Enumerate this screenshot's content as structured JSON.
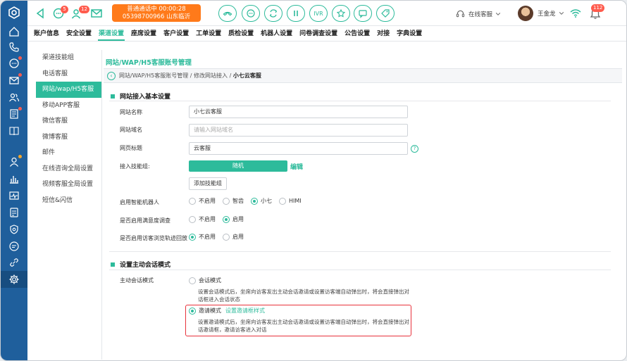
{
  "topbar": {
    "badges": {
      "messages": "5",
      "visitors": "12",
      "alerts": "112"
    },
    "call": {
      "line1": "普通通话中 00:00:28",
      "line2": "05398700966 山东临沂"
    },
    "ivr_label": "IVR",
    "status_label": "在线客服",
    "user_name": "王金龙"
  },
  "menu": {
    "items": [
      "账户信息",
      "安全设置",
      "渠道设置",
      "座席设置",
      "客户设置",
      "工单设置",
      "质检设置",
      "机器人设置",
      "问卷调查设置",
      "公告设置",
      "对接",
      "字典设置"
    ],
    "active_index": 2
  },
  "sidebar": {
    "items": [
      "渠道技能组",
      "电话客服",
      "网站/wap/H5客服",
      "移动APP客服",
      "微信客服",
      "微博客服",
      "邮件",
      "在线咨询全局设置",
      "视频客服全局设置",
      "短信&闪信"
    ],
    "active_index": 2
  },
  "main": {
    "tab_title": "网站/WAP/H5客服账号管理",
    "breadcrumb": {
      "part1": "网站/WAP/H5客服账号管理",
      "sep": " / ",
      "part2": "修改网站接入",
      "part3": "小七云客服"
    },
    "section1_title": "网站接入基本设置",
    "site_name": {
      "label": "网站名称",
      "value": "小七云客服"
    },
    "site_domain": {
      "label": "网站域名",
      "placeholder": "请输入网站域名"
    },
    "page_title": {
      "label": "网页标题",
      "value": "云客服",
      "help": "?"
    },
    "skill_group": {
      "label": "接入技能组:",
      "selected": "随机",
      "edit_link": "编辑",
      "add_button": "添加技能组"
    },
    "robot": {
      "label": "启用智能机器人",
      "options": [
        "不启用",
        "智齿",
        "小七",
        "HIMI"
      ],
      "selected_index": 2
    },
    "satisfaction": {
      "label": "是否启用满意度调查",
      "options": [
        "不启用",
        "启用"
      ],
      "selected_index": 1
    },
    "trace": {
      "label": "是否启用访客浏览轨迹回放",
      "options": [
        "不启用",
        "启用"
      ],
      "selected_index": 0
    },
    "section2_title": "设置主动会话模式",
    "proactive": {
      "label": "主动会话模式",
      "session_mode": {
        "label": "会话模式",
        "desc": "设置会话模式后，坐席向访客发出主动会话邀请或设置访客端自动弹出时，将会直接弹出对话框进入会话状态"
      },
      "invite_mode": {
        "label": "邀请模式",
        "link": "设置邀请框样式",
        "desc": "设置邀请模式后，坐席向访客发出主动会话邀请或设置访客端自动弹出时，将会直接弹出对话邀请框，邀请访客进入对话"
      },
      "selected": "invite"
    }
  },
  "colors": {
    "accent": "#2dbb9b",
    "rail": "#1f5f9c",
    "call": "#ff7a1a",
    "badge": "#ff5b4d",
    "highlight": "#e8323c"
  },
  "icons": [
    "home-icon",
    "phone-icon",
    "chat-icon",
    "mail-icon",
    "users-icon",
    "list-icon",
    "book-icon",
    "agent-icon",
    "chart-icon",
    "monitor-icon",
    "form-icon",
    "shield-icon",
    "bubble-icon",
    "link-icon",
    "gear-icon"
  ]
}
